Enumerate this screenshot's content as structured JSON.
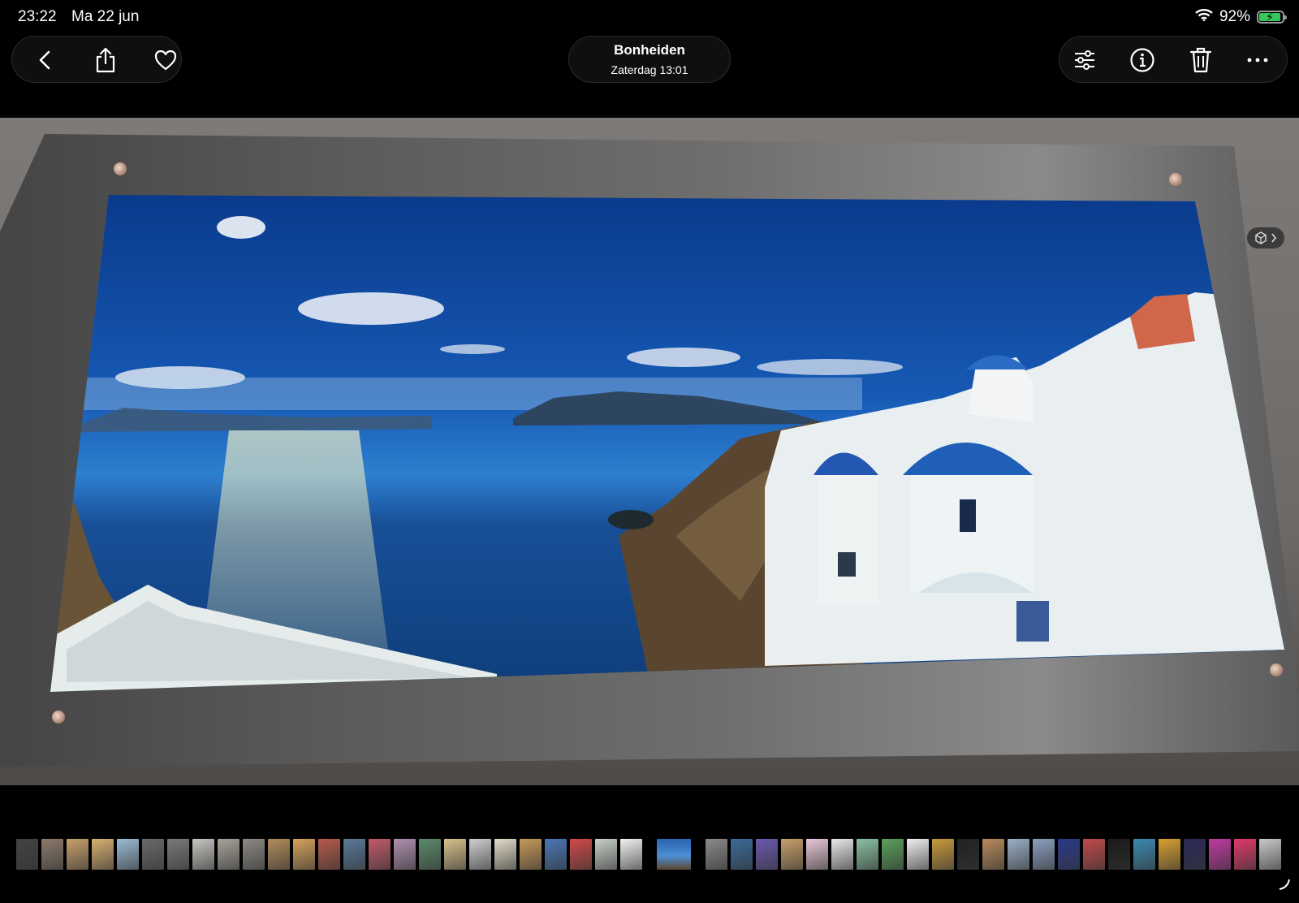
{
  "status": {
    "time": "23:22",
    "date": "Ma 22 jun",
    "battery_percent": "92%",
    "battery_level": 0.92,
    "battery_color": "#35c759"
  },
  "toolbar_left": {
    "back": "chevron-left-icon",
    "share": "share-icon",
    "favorite": "heart-icon"
  },
  "location": {
    "title": "Bonheiden",
    "subtitle": "Zaterdag  13:01"
  },
  "toolbar_right": {
    "adjust": "sliders-icon",
    "info": "info-icon",
    "delete": "trash-icon",
    "more": "ellipsis-icon"
  },
  "photo": {
    "view_badge_icon": "live-text-icon"
  },
  "filmstrip": {
    "thumbs": [
      "#444",
      "#8b7a6a",
      "#c9a16b",
      "#d9b070",
      "#9bbcd6",
      "#6a6a6a",
      "#7a7a78",
      "#c8c6c2",
      "#a9a39a",
      "#8e8a84",
      "#b28c5a",
      "#d6a35c",
      "#b55a4a",
      "#5a7a9a",
      "#c25a6a",
      "#b08fb0",
      "#5a8a6a",
      "#d8c28a",
      "#cfcfcf",
      "#e2dcc8",
      "#c79a5a",
      "#4a78b8",
      "#d04a4a",
      "#c8d0c8",
      "#f2f2f2",
      "CURRENT",
      "#8a8a8a",
      "#3a6a9a",
      "#6a5ab0",
      "#c8a06a",
      "#e8c8d8",
      "#e8e8e8",
      "#8ac0a0",
      "#5aa05a",
      "#f0f0f0",
      "#c89a3a",
      "#222",
      "#b88a5a",
      "#9ab0c8",
      "#8aa0c0",
      "#2a3a8a",
      "#c04a4a",
      "#1a1a1a",
      "#3a8ab0",
      "#d8a030",
      "#2a2a5a",
      "#c03aa0",
      "#e03a6a",
      "#c8c8c8",
      "#888"
    ],
    "current_color": "#2f6fb8"
  }
}
